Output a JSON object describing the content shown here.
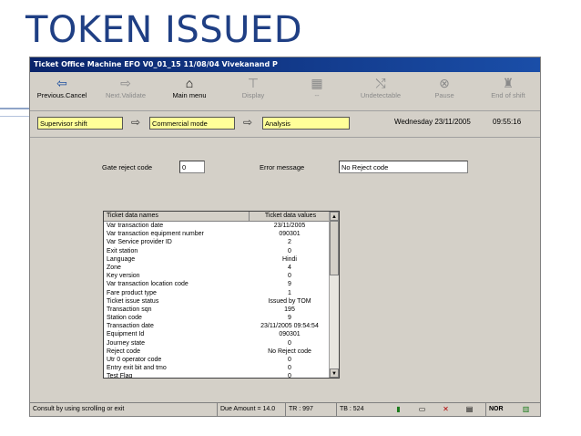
{
  "slide": {
    "title": "TOKEN ISSUED"
  },
  "window": {
    "title": "Ticket Office Machine EFO V0_01_15 11/08/04 Vivekanand P"
  },
  "toolbar": {
    "previous_cancel": "Previous.Cancel",
    "next_validate": "Next.Validate",
    "main_menu": "Main menu",
    "display": "Display",
    "dash": "--",
    "undetectable": "Undetectable",
    "pause": "Pause",
    "end_of_shift": "End of shift"
  },
  "modes": {
    "supervisor": "Supervisor shift",
    "commercial": "Commercial mode",
    "analysis": "Analysis",
    "date": "Wednesday 23/11/2005",
    "time": "09:55:16"
  },
  "form": {
    "gate_reject_label": "Gate reject code",
    "gate_reject_value": "0",
    "error_label": "Error message",
    "error_value": "No Reject code"
  },
  "table": {
    "col1": "Ticket data names",
    "col2": "Ticket data values",
    "rows": [
      {
        "name": "Var transaction date",
        "value": "23/11/2005"
      },
      {
        "name": "Var transaction equipment number",
        "value": "090301"
      },
      {
        "name": "Var Service provider ID",
        "value": "2"
      },
      {
        "name": "Exit station",
        "value": "0"
      },
      {
        "name": "Language",
        "value": "Hindi"
      },
      {
        "name": "Zone",
        "value": "4"
      },
      {
        "name": "Key version",
        "value": "0"
      },
      {
        "name": "Var transaction location code",
        "value": "9"
      },
      {
        "name": "Fare product type",
        "value": "1"
      },
      {
        "name": "Ticket issue status",
        "value": "Issued by TOM"
      },
      {
        "name": "Transaction sqn",
        "value": "195"
      },
      {
        "name": "Station code",
        "value": "9"
      },
      {
        "name": "Transaction date",
        "value": "23/11/2005 09:54:54"
      },
      {
        "name": "Equipment Id",
        "value": "090301"
      },
      {
        "name": "Journey state",
        "value": "0"
      },
      {
        "name": "Reject code",
        "value": "No Reject code"
      },
      {
        "name": "Utr 0 operator code",
        "value": "0"
      },
      {
        "name": "Entry exit bit and tmo",
        "value": "0"
      },
      {
        "name": "Test Flag",
        "value": "0"
      }
    ]
  },
  "status": {
    "hint": "Consult by using scrolling or exit",
    "due": "Due Amount = 14.0",
    "tr": "TR : 997",
    "tb": "TB : 524",
    "nor": "NOR"
  },
  "icons": {
    "previous": "back-arrow-icon",
    "next": "forward-arrow-icon",
    "main_menu": "house-icon",
    "display": "pin-icon",
    "dash": "calculator-icon",
    "undetectable": "crossed-arrows-icon",
    "pause": "pause-circle-icon",
    "end_of_shift": "person-exit-icon"
  }
}
